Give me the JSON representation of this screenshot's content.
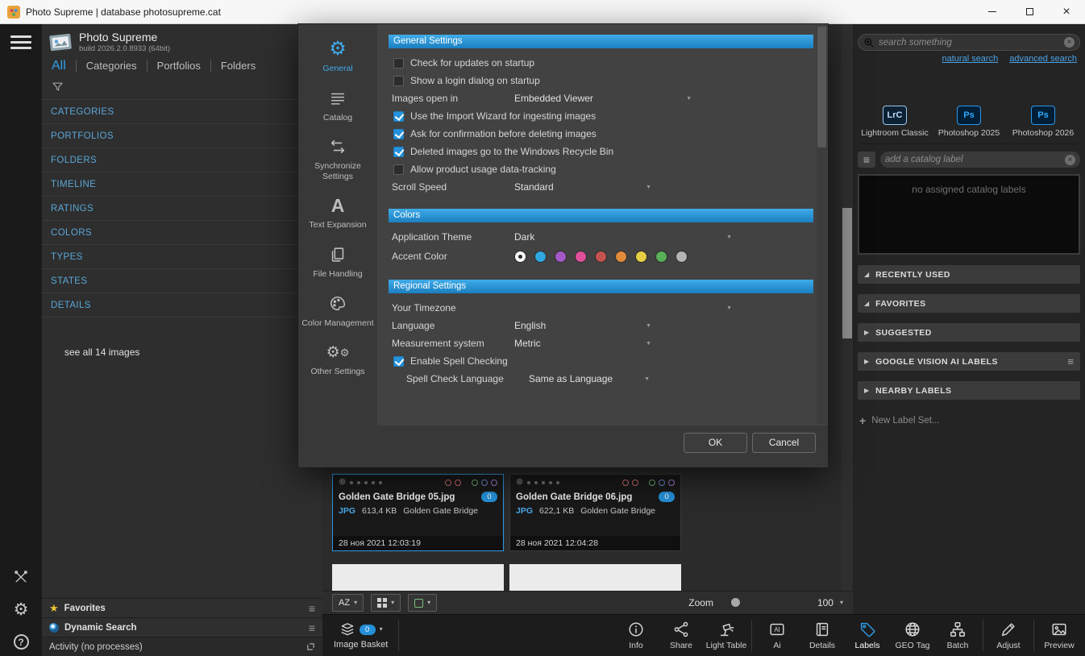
{
  "titlebar": {
    "title": "Photo Supreme | database photosupreme.cat"
  },
  "left_panel": {
    "app_name": "Photo Supreme",
    "build_info": "build 2026.2.0.8933 (64bit)",
    "tabs": [
      {
        "label": "All",
        "active": true
      },
      {
        "label": "Categories",
        "active": false
      },
      {
        "label": "Portfolios",
        "active": false
      },
      {
        "label": "Folders",
        "active": false
      }
    ],
    "items": [
      {
        "label": "CATEGORIES"
      },
      {
        "label": "PORTFOLIOS"
      },
      {
        "label": "FOLDERS"
      },
      {
        "label": "TIMELINE"
      },
      {
        "label": "RATINGS"
      },
      {
        "label": "COLORS"
      },
      {
        "label": "TYPES"
      },
      {
        "label": "STATES"
      },
      {
        "label": "DETAILS"
      }
    ],
    "see_all_label": "see all 14 images",
    "favorites_label": "Favorites",
    "dynamic_search_label": "Dynamic Search",
    "activity_label": "Activity (no processes)"
  },
  "dialog": {
    "nav": [
      {
        "label": "General",
        "active": true
      },
      {
        "label": "Catalog",
        "active": false
      },
      {
        "label": "Synchronize Settings",
        "active": false
      },
      {
        "label": "Text Expansion",
        "active": false
      },
      {
        "label": "File Handling",
        "active": false
      },
      {
        "label": "Color Management",
        "active": false
      },
      {
        "label": "Other Settings",
        "active": false
      }
    ],
    "general": {
      "title": "General Settings",
      "check_updates": {
        "label": "Check for updates on startup",
        "checked": false
      },
      "login_dialog": {
        "label": "Show a login dialog on startup",
        "checked": false
      },
      "images_open_in": {
        "label": "Images open in",
        "value": "Embedded Viewer"
      },
      "import_wizard": {
        "label": "Use the Import Wizard for ingesting images",
        "checked": true
      },
      "confirm_delete": {
        "label": "Ask for confirmation before deleting images",
        "checked": true
      },
      "recycle_bin": {
        "label": "Deleted images go to the Windows Recycle Bin",
        "checked": true
      },
      "usage_tracking": {
        "label": "Allow product usage data-tracking",
        "checked": false
      },
      "scroll_speed": {
        "label": "Scroll Speed",
        "value": "Standard"
      }
    },
    "colors": {
      "title": "Colors",
      "app_theme": {
        "label": "Application Theme",
        "value": "Dark"
      },
      "accent": {
        "label": "Accent Color",
        "selected_index": 0,
        "swatches": [
          "#ffffff",
          "#2fa7e0",
          "#a458c8",
          "#e04f99",
          "#c45350",
          "#e08b3a",
          "#e6cf45",
          "#58b058",
          "#b4b4b4"
        ]
      }
    },
    "regional": {
      "title": "Regional Settings",
      "timezone": {
        "label": "Your Timezone",
        "value": ""
      },
      "language": {
        "label": "Language",
        "value": "English"
      },
      "measurement": {
        "label": "Measurement system",
        "value": "Metric"
      },
      "spell_checking": {
        "label": "Enable Spell Checking",
        "checked": true
      },
      "spell_language": {
        "label": "Spell Check Language",
        "value": "Same as Language"
      }
    },
    "ok_label": "OK",
    "cancel_label": "Cancel"
  },
  "thumbnails": {
    "color_labels": [
      "#d27070",
      "#d27070",
      "#6fae6f",
      "#6f8ed2",
      "#a97fd2"
    ],
    "cards": [
      {
        "filename": "Golden Gate Bridge 05.jpg",
        "version_count": "0",
        "format": "JPG",
        "file_size": "613,4 KB",
        "title": "Golden Gate Bridge",
        "datetime": "28 ноя 2021 12:03:19",
        "selected": true
      },
      {
        "filename": "Golden Gate Bridge 06.jpg",
        "version_count": "0",
        "format": "JPG",
        "file_size": "622,1 KB",
        "title": "Golden Gate Bridge",
        "datetime": "28 ноя 2021 12:04:28",
        "selected": false
      }
    ]
  },
  "sort_bar": {
    "sort_label": "AZ",
    "zoom_label": "Zoom",
    "zoom_value": "100"
  },
  "toolbar": {
    "image_basket": {
      "label": "Image Basket",
      "count": "0"
    },
    "buttons": [
      {
        "label": "Info",
        "active": false
      },
      {
        "label": "Share",
        "active": false
      },
      {
        "label": "Light Table",
        "active": false
      },
      {
        "label": "Ai",
        "active": false
      },
      {
        "label": "Details",
        "active": false
      },
      {
        "label": "Labels",
        "active": true
      },
      {
        "label": "GEO Tag",
        "active": false
      },
      {
        "label": "Batch",
        "active": false
      },
      {
        "label": "Adjust",
        "active": false
      },
      {
        "label": "Preview",
        "active": false
      }
    ]
  },
  "right_panel": {
    "search_placeholder": "search something",
    "links": {
      "natural": "natural search",
      "advanced": "advanced search"
    },
    "apps": [
      {
        "abbr": "LrC",
        "label": "Lightroom Classic"
      },
      {
        "abbr": "Ps",
        "label": "Photoshop 2025"
      },
      {
        "abbr": "Ps",
        "label": "Photoshop 2026"
      }
    ],
    "add_label_placeholder": "add a catalog label",
    "empty_message": "no assigned catalog labels",
    "sections": [
      {
        "label": "RECENTLY USED",
        "expanded": true,
        "has_menu": false
      },
      {
        "label": "FAVORITES",
        "expanded": true,
        "has_menu": false
      },
      {
        "label": "SUGGESTED",
        "expanded": false,
        "has_menu": false
      },
      {
        "label": "GOOGLE VISION AI LABELS",
        "expanded": false,
        "has_menu": true
      },
      {
        "label": "NEARBY LABELS",
        "expanded": false,
        "has_menu": false
      }
    ],
    "new_label_set_label": "New Label Set..."
  }
}
